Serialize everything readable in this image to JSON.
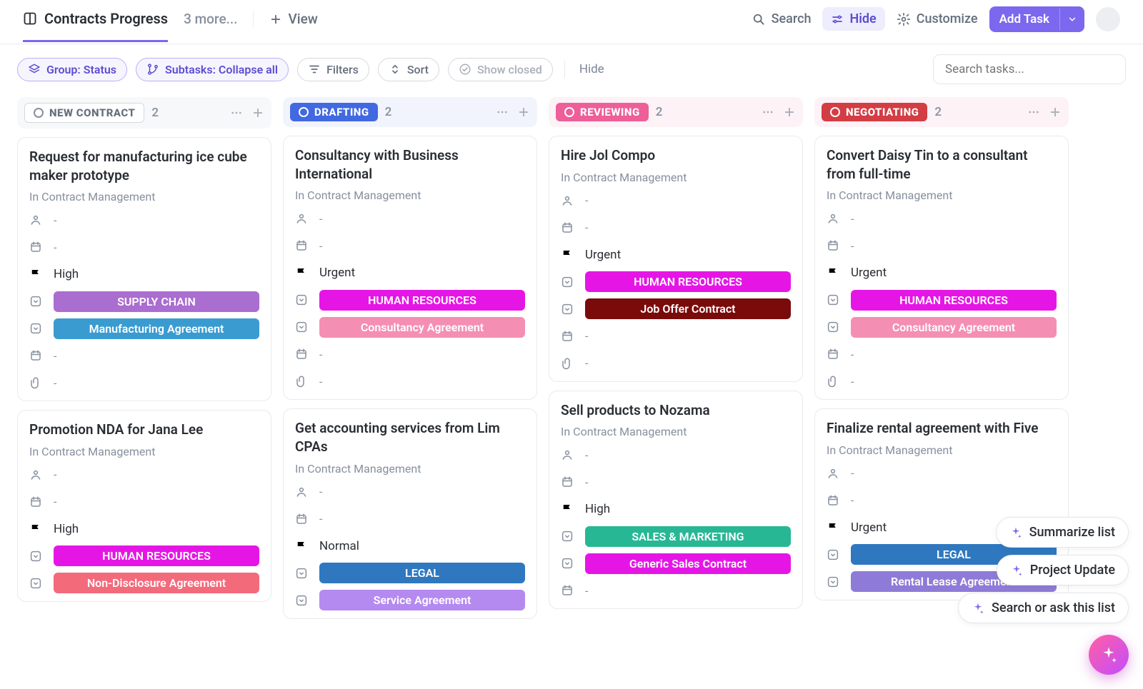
{
  "header": {
    "board_title": "Contracts Progress",
    "more_label": "3 more...",
    "view_label": "View",
    "search_label": "Search",
    "hide_label": "Hide",
    "customize_label": "Customize",
    "add_task_label": "Add Task"
  },
  "filters": {
    "group_label": "Group: Status",
    "subtasks_label": "Subtasks: Collapse all",
    "filters_label": "Filters",
    "sort_label": "Sort",
    "show_closed_label": "Show closed",
    "hide_label": "Hide",
    "search_placeholder": "Search tasks..."
  },
  "ai": {
    "summarize": "Summarize list",
    "project_update": "Project Update",
    "search_ask": "Search or ask this list"
  },
  "columns": [
    {
      "status": "NEW CONTRACT",
      "count": "2",
      "style": "gray",
      "cards": [
        {
          "title": "Request for manufacturing ice cube maker prototype",
          "subtitle": "In Contract Management",
          "priority": "High",
          "priority_color": "high",
          "tags": [
            {
              "label": "SUPPLY CHAIN",
              "cls": "supply"
            },
            {
              "label": "Manufacturing Agreement",
              "cls": "manuf"
            }
          ],
          "extra_rows": [
            "date",
            "clip"
          ]
        },
        {
          "title": "Promotion NDA for Jana Lee",
          "subtitle": "In Contract Management",
          "priority": "High",
          "priority_color": "high",
          "tags": [
            {
              "label": "HUMAN RESOURCES",
              "cls": "hr"
            },
            {
              "label": "Non-Disclosure Agreement",
              "cls": "nda"
            }
          ],
          "extra_rows": []
        }
      ]
    },
    {
      "status": "DRAFTING",
      "count": "2",
      "style": "blue",
      "cards": [
        {
          "title": "Consultancy with Business International",
          "subtitle": "In Contract Management",
          "priority": "Urgent",
          "priority_color": "urgent",
          "tags": [
            {
              "label": "HUMAN RESOURCES",
              "cls": "hr"
            },
            {
              "label": "Consultancy Agreement",
              "cls": "consult"
            }
          ],
          "extra_rows": [
            "date",
            "clip"
          ]
        },
        {
          "title": "Get accounting services from Lim CPAs",
          "subtitle": "In Contract Management",
          "priority": "Normal",
          "priority_color": "normal",
          "tags": [
            {
              "label": "LEGAL",
              "cls": "legal"
            },
            {
              "label": "Service Agreement",
              "cls": "service"
            }
          ],
          "extra_rows": []
        }
      ]
    },
    {
      "status": "REVIEWING",
      "count": "2",
      "style": "pink",
      "cards": [
        {
          "title": "Hire Jol Compo",
          "subtitle": "In Contract Management",
          "priority": "Urgent",
          "priority_color": "urgent",
          "tags": [
            {
              "label": "HUMAN RESOURCES",
              "cls": "hr"
            },
            {
              "label": "Job Offer Contract",
              "cls": "joboffer"
            }
          ],
          "extra_rows": [
            "date",
            "clip"
          ]
        },
        {
          "title": "Sell products to Nozama",
          "subtitle": "In Contract Management",
          "priority": "High",
          "priority_color": "high",
          "tags": [
            {
              "label": "SALES & MARKETING",
              "cls": "sales"
            },
            {
              "label": "Generic Sales Contract",
              "cls": "salesc"
            }
          ],
          "extra_rows": [
            "date"
          ]
        }
      ]
    },
    {
      "status": "NEGOTIATING",
      "count": "2",
      "style": "red",
      "cards": [
        {
          "title": "Convert Daisy Tin to a consultant from full-time",
          "subtitle": "In Contract Management",
          "priority": "Urgent",
          "priority_color": "urgent",
          "tags": [
            {
              "label": "HUMAN RESOURCES",
              "cls": "hr"
            },
            {
              "label": "Consultancy Agreement",
              "cls": "consult"
            }
          ],
          "extra_rows": [
            "date",
            "clip"
          ]
        },
        {
          "title": "Finalize rental agreement with Five",
          "subtitle": "In Contract Management",
          "priority": "Urgent",
          "priority_color": "urgent",
          "tags": [
            {
              "label": "LEGAL",
              "cls": "legal"
            },
            {
              "label": "Rental Lease Agreement",
              "cls": "rental"
            }
          ],
          "extra_rows": []
        }
      ]
    }
  ]
}
